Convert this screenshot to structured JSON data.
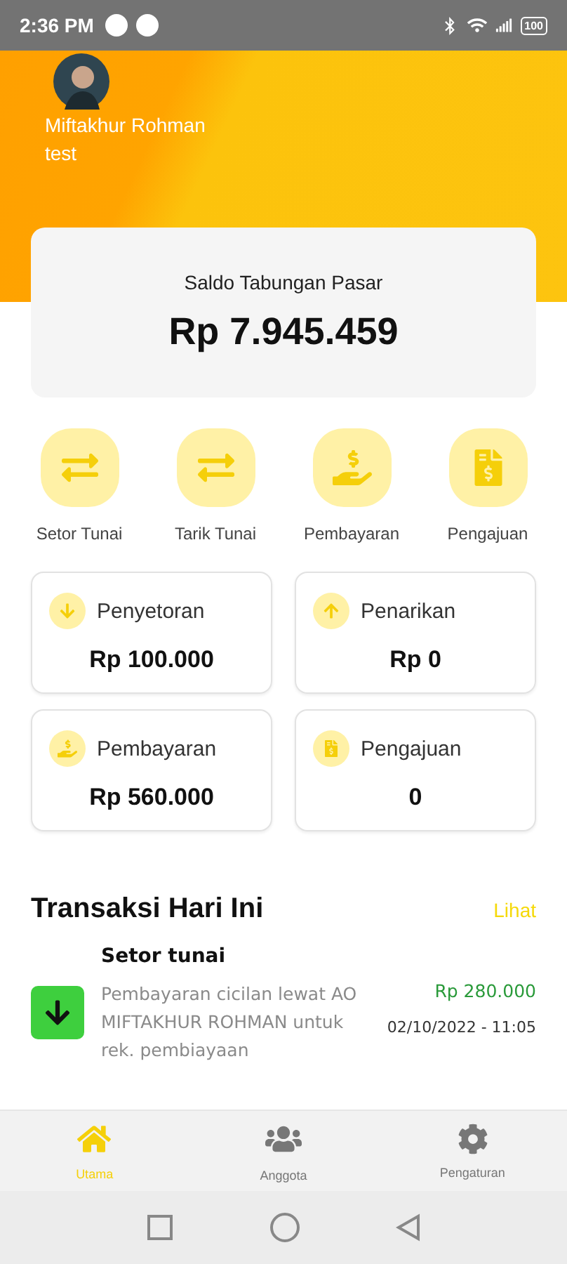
{
  "status_bar": {
    "time": "2:36 PM",
    "battery": "100"
  },
  "profile": {
    "name": "Miftakhur Rohman",
    "subtitle": "test"
  },
  "balance": {
    "label": "Saldo Tabungan Pasar",
    "amount": "Rp 7.945.459"
  },
  "quick_actions": [
    {
      "kind": "transfer",
      "label": "Setor Tunai"
    },
    {
      "kind": "transfer",
      "label": "Tarik Tunai"
    },
    {
      "kind": "payment",
      "label": "Pembayaran"
    },
    {
      "kind": "document",
      "label": "Pengajuan"
    }
  ],
  "stats": [
    {
      "kind": "down",
      "label": "Penyetoran",
      "value": "Rp 100.000"
    },
    {
      "kind": "up",
      "label": "Penarikan",
      "value": "Rp 0"
    },
    {
      "kind": "payment",
      "label": "Pembayaran",
      "value": "Rp 560.000"
    },
    {
      "kind": "document",
      "label": "Pengajuan",
      "value": "0"
    }
  ],
  "transactions": {
    "title": "Transaksi Hari Ini",
    "link": "Lihat",
    "items": [
      {
        "kind": "deposit",
        "type": "Setor tunai",
        "description": "Pembayaran cicilan lewat AO MIFTAKHUR ROHMAN untuk rek. pembiayaan",
        "amount": "Rp 280.000",
        "datetime": "02/10/2022 - 11:05"
      }
    ]
  },
  "bottom_nav": [
    {
      "label": "Utama",
      "kind": "home",
      "selected": true
    },
    {
      "label": "Anggota",
      "kind": "users",
      "selected": false
    },
    {
      "label": "Pengaturan",
      "kind": "gear",
      "selected": false
    }
  ]
}
